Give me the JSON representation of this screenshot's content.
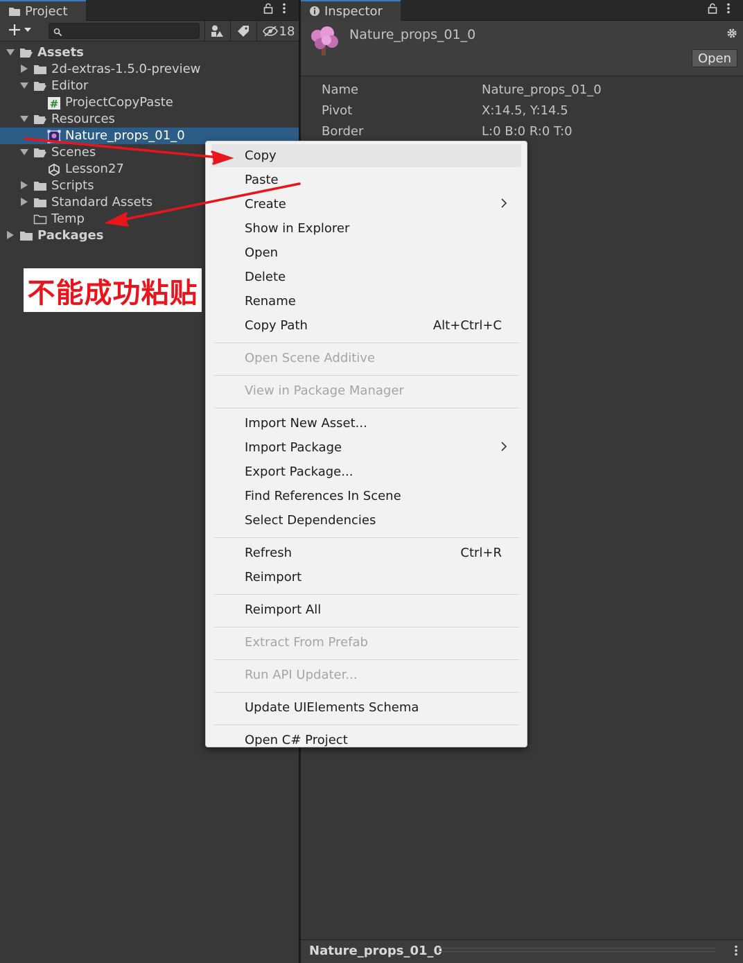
{
  "project": {
    "tab_label": "Project",
    "hidden_count": "18",
    "tree": [
      {
        "label": "Assets",
        "depth": 0,
        "arrow": "open",
        "icon": "folder-open",
        "bold": true
      },
      {
        "label": "2d-extras-1.5.0-preview",
        "depth": 1,
        "arrow": "closed",
        "icon": "folder"
      },
      {
        "label": "Editor",
        "depth": 1,
        "arrow": "open",
        "icon": "folder-open"
      },
      {
        "label": "ProjectCopyPaste",
        "depth": 2,
        "arrow": "none",
        "icon": "csharp-script"
      },
      {
        "label": "Resources",
        "depth": 1,
        "arrow": "open",
        "icon": "folder-open"
      },
      {
        "label": "Nature_props_01_0",
        "depth": 2,
        "arrow": "none",
        "icon": "sprite",
        "selected": true
      },
      {
        "label": "Scenes",
        "depth": 1,
        "arrow": "open",
        "icon": "folder-open"
      },
      {
        "label": "Lesson27",
        "depth": 2,
        "arrow": "none",
        "icon": "unity-scene"
      },
      {
        "label": "Scripts",
        "depth": 1,
        "arrow": "closed",
        "icon": "folder"
      },
      {
        "label": "Standard Assets",
        "depth": 1,
        "arrow": "closed",
        "icon": "folder"
      },
      {
        "label": "Temp",
        "depth": 1,
        "arrow": "none",
        "icon": "folder-empty"
      },
      {
        "label": "Packages",
        "depth": 0,
        "arrow": "closed",
        "icon": "folder",
        "bold": true
      }
    ]
  },
  "annotation": {
    "note": "不能成功粘贴",
    "note_color": "#e8161c"
  },
  "inspector": {
    "tab_label": "Inspector",
    "title": "Nature_props_01_0",
    "open_label": "Open",
    "props": [
      {
        "name": "Name",
        "value": "Nature_props_01_0"
      },
      {
        "name": "Pivot",
        "value": "X:14.5, Y:14.5"
      },
      {
        "name": "Border",
        "value": "L:0 B:0 R:0 T:0"
      }
    ],
    "footer_label": "Nature_props_01_0"
  },
  "menu": {
    "groups": [
      [
        {
          "label": "Copy",
          "highlighted": true
        },
        {
          "label": "Paste"
        },
        {
          "label": "Create",
          "submenu": true
        },
        {
          "label": "Show in Explorer"
        },
        {
          "label": "Open"
        },
        {
          "label": "Delete"
        },
        {
          "label": "Rename"
        },
        {
          "label": "Copy Path",
          "shortcut": "Alt+Ctrl+C"
        }
      ],
      [
        {
          "label": "Open Scene Additive",
          "disabled": true
        }
      ],
      [
        {
          "label": "View in Package Manager",
          "disabled": true
        }
      ],
      [
        {
          "label": "Import New Asset..."
        },
        {
          "label": "Import Package",
          "submenu": true
        },
        {
          "label": "Export Package..."
        },
        {
          "label": "Find References In Scene"
        },
        {
          "label": "Select Dependencies"
        }
      ],
      [
        {
          "label": "Refresh",
          "shortcut": "Ctrl+R"
        },
        {
          "label": "Reimport"
        }
      ],
      [
        {
          "label": "Reimport All"
        }
      ],
      [
        {
          "label": "Extract From Prefab",
          "disabled": true
        }
      ],
      [
        {
          "label": "Run API Updater...",
          "disabled": true
        }
      ],
      [
        {
          "label": "Update UIElements Schema"
        }
      ],
      [
        {
          "label": "Open C# Project"
        }
      ]
    ]
  },
  "colors": {
    "panel_bg": "#383838",
    "selection": "#2c5d87",
    "tab_accent": "#3a79bb",
    "menu_bg": "#f2f2f2",
    "arrow_red": "#e8161c"
  }
}
